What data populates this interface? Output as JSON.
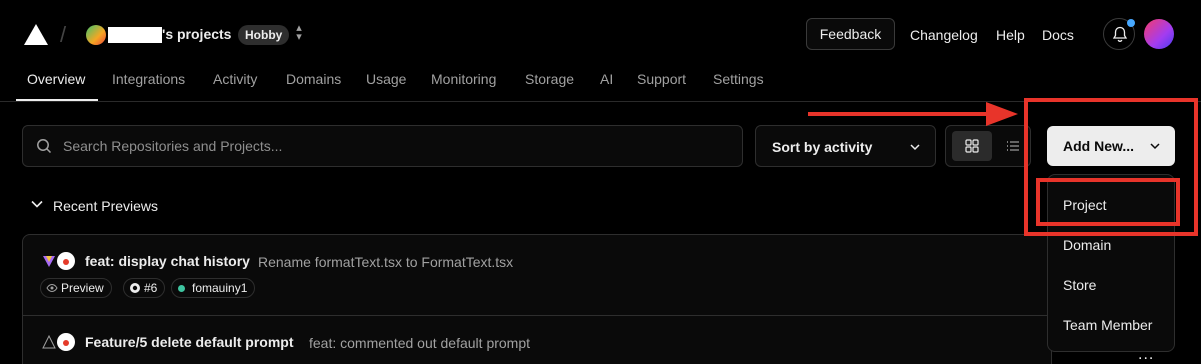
{
  "header": {
    "team_name": "'s projects",
    "plan_badge": "Hobby",
    "feedback_label": "Feedback",
    "nav_links": [
      "Changelog",
      "Help",
      "Docs"
    ]
  },
  "tabs": [
    "Overview",
    "Integrations",
    "Activity",
    "Domains",
    "Usage",
    "Monitoring",
    "Storage",
    "AI",
    "Support",
    "Settings"
  ],
  "active_tab": "Overview",
  "toolbar": {
    "search_placeholder": "Search Repositories and Projects...",
    "sort_label": "Sort by activity",
    "add_new_label": "Add New..."
  },
  "dropdown": {
    "items": [
      "Project",
      "Domain",
      "Store",
      "Team Member"
    ]
  },
  "recent": {
    "title": "Recent Previews",
    "cards": [
      {
        "title": "feat: display chat history",
        "message": "Rename formatText.tsx to FormatText.tsx",
        "chips": [
          "Preview",
          "#6",
          "fomauiny1"
        ]
      },
      {
        "title": "Feature/5 delete default prompt",
        "message": "feat: commented out default prompt"
      }
    ],
    "more_label": "..."
  },
  "colors": {
    "annotation": "#e8342a",
    "accent_blue": "#47a8ff",
    "background": "#000000"
  },
  "icons": [
    "vercel-logo-icon",
    "switch-icon",
    "bell-icon",
    "search-icon",
    "chevron-down-icon",
    "grid-view-icon",
    "list-view-icon",
    "eye-icon",
    "github-icon",
    "commit-icon"
  ]
}
